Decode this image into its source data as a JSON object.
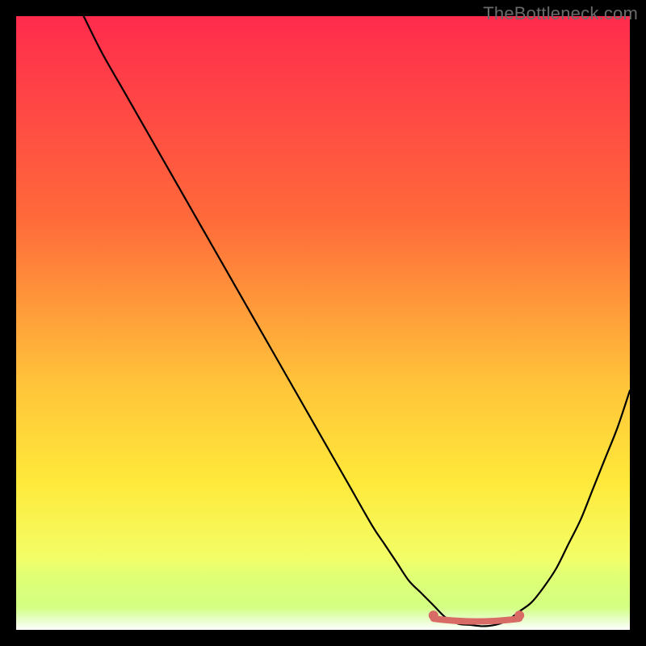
{
  "watermark": {
    "text": "TheBottleneck.com"
  },
  "chart_data": {
    "type": "line",
    "title": "",
    "xlabel": "",
    "ylabel": "",
    "xlim": [
      0,
      100
    ],
    "ylim": [
      0,
      100
    ],
    "grid": false,
    "series": [
      {
        "name": "curve",
        "x": [
          11,
          14,
          18,
          22,
          26,
          30,
          34,
          38,
          42,
          46,
          50,
          54,
          58,
          60,
          62,
          64,
          66,
          68,
          70,
          72,
          74,
          76,
          78,
          80,
          82,
          84,
          86,
          88,
          90,
          92,
          94,
          96,
          98,
          100
        ],
        "values": [
          100,
          94,
          87,
          80,
          73,
          66,
          59,
          52,
          45,
          38,
          31,
          24,
          17,
          14,
          11,
          8,
          6,
          4,
          2,
          1,
          0.8,
          0.6,
          0.8,
          1.5,
          3,
          4.5,
          7,
          10,
          14,
          18,
          23,
          28,
          33,
          39
        ]
      }
    ],
    "annotations": [
      {
        "name": "sweet-spot",
        "x_start": 68,
        "x_end": 82,
        "y": 1.3
      }
    ]
  }
}
